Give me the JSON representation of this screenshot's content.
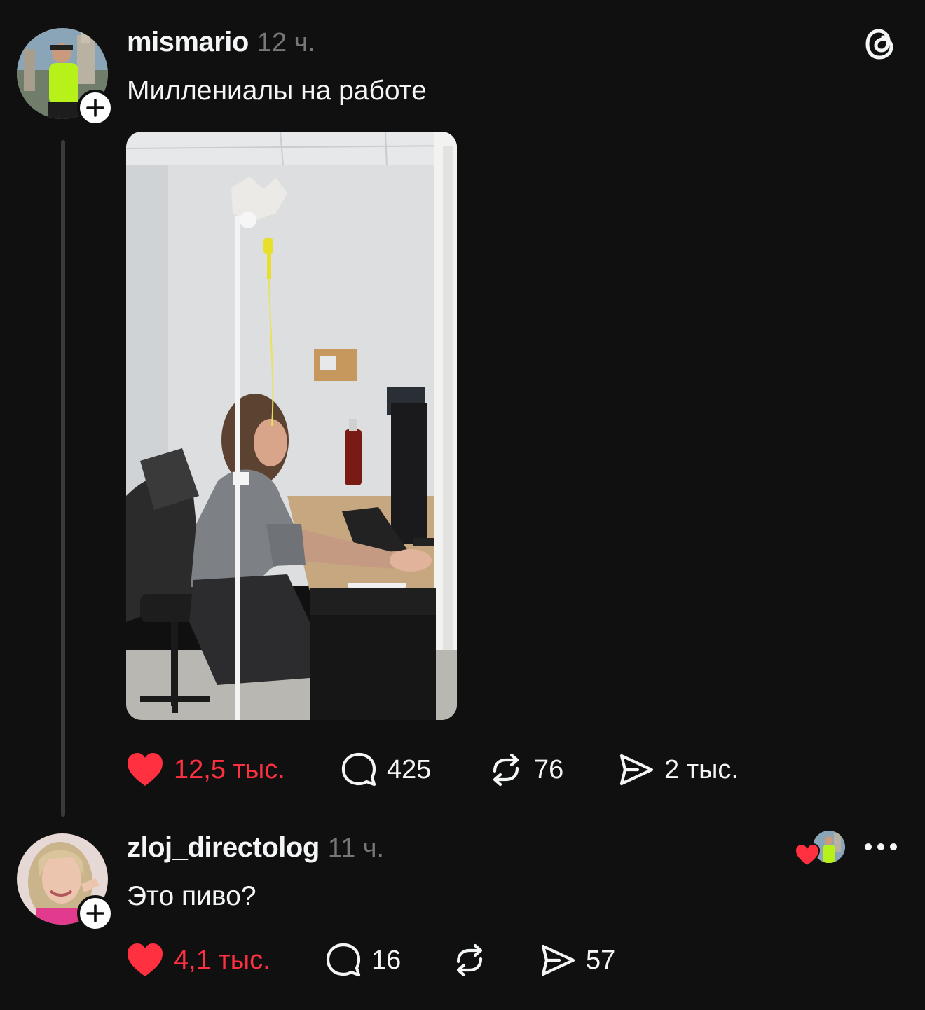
{
  "app": {
    "logo_icon": "threads-logo-icon"
  },
  "post": {
    "username": "mismario",
    "time": "12 ч.",
    "text": "Миллениалы на работе",
    "likes": "12,5 тыс.",
    "replies": "425",
    "reposts": "76",
    "shares": "2 тыс."
  },
  "reply": {
    "username": "zloj_directolog",
    "time": "11 ч.",
    "text": "Это пиво?",
    "likes": "4,1 тыс.",
    "replies": "16",
    "shares": "57"
  },
  "colors": {
    "background": "#101010",
    "like_red": "#ff3040",
    "muted": "#777777"
  }
}
